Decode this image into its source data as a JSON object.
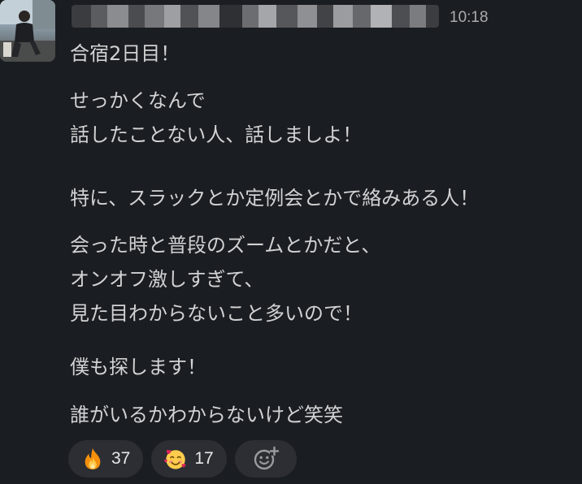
{
  "message": {
    "timestamp": "10:18",
    "lines": {
      "l1": "合宿2日目！",
      "l2": "せっかくなんで",
      "l3": "話したことない人、話しましよ！",
      "l4": "特に、スラックとか定例会とかで絡みある人！",
      "l5": "会った時と普段のズームとかだと、",
      "l6": "オンオフ激しすぎて、",
      "l7": "見た目わからないこと多いので！",
      "l8": "僕も探します！",
      "l9": "誰がいるかわからないけど笑笑"
    }
  },
  "reactions": {
    "fire": {
      "icon": "fire-emoji-icon",
      "count": "37"
    },
    "hearts": {
      "icon": "smiling-face-with-hearts-emoji-icon",
      "count": "17"
    },
    "add": {
      "icon": "add-reaction-icon"
    }
  }
}
